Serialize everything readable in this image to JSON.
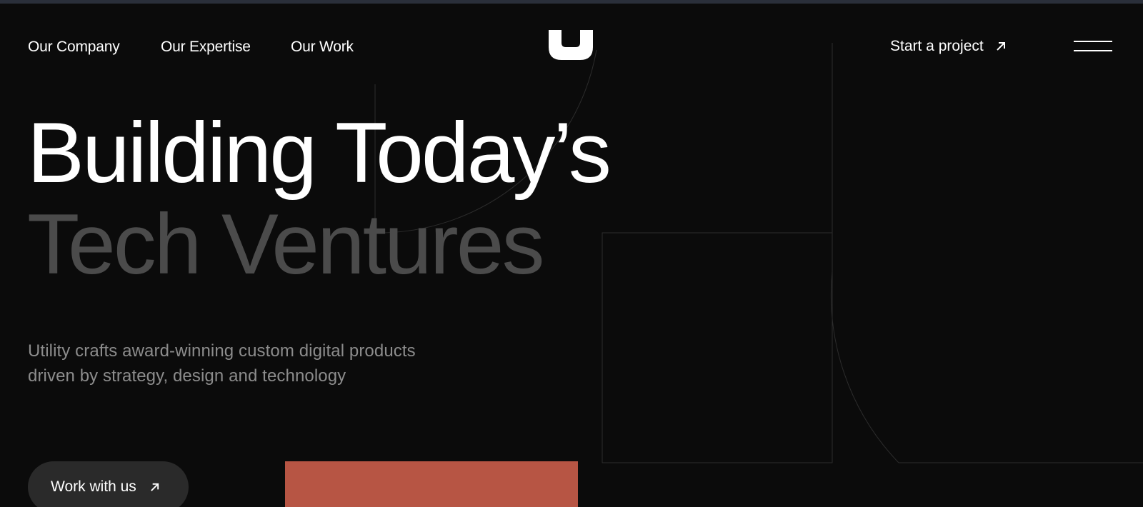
{
  "nav": {
    "links": [
      {
        "label": "Our Company"
      },
      {
        "label": "Our Expertise"
      },
      {
        "label": "Our Work"
      }
    ],
    "logo_icon": "utility-u-logo-icon",
    "cta_label": "Start a project",
    "cta_icon": "arrow-up-right-icon",
    "menu_icon": "hamburger-menu-icon"
  },
  "hero": {
    "headline_line1": "Building Today’s",
    "headline_line2": "Tech Ventures",
    "subtitle_line1": "Utility crafts award-winning custom digital products",
    "subtitle_line2": "driven by strategy, design and technology",
    "button_label": "Work with us",
    "button_icon": "arrow-up-right-icon"
  },
  "colors": {
    "background": "#0b0b0b",
    "text_primary": "#ffffff",
    "text_muted": "#4b4b4b",
    "subtitle": "#8c8c8c",
    "button_bg": "#2a2a2a",
    "accent_block": "#b75544",
    "decor_line": "#2c2c2c"
  }
}
